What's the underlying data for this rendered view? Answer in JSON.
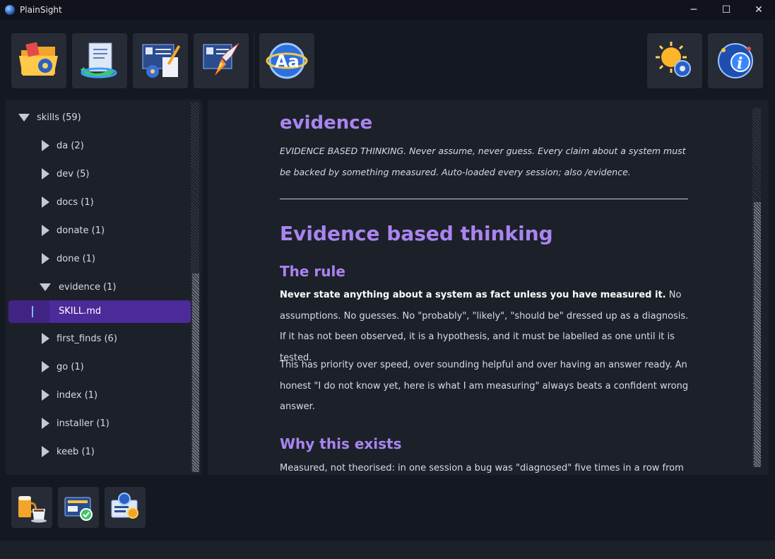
{
  "window": {
    "title": "PlainSight",
    "minimize": "─",
    "maximize": "☐",
    "close": "✕"
  },
  "toolbar": {
    "left_buttons": [
      "open-folder-icon",
      "reload-document-icon",
      "edit-document-icon",
      "publish-document-icon",
      "font-settings-icon"
    ],
    "right_buttons": [
      "theme-settings-icon",
      "about-info-icon"
    ]
  },
  "tree": {
    "root": "skills (59)",
    "items": [
      {
        "label": "da (2)",
        "expanded": false
      },
      {
        "label": "dev (5)",
        "expanded": false
      },
      {
        "label": "docs (1)",
        "expanded": false
      },
      {
        "label": "donate (1)",
        "expanded": false
      },
      {
        "label": "done (1)",
        "expanded": false
      },
      {
        "label": "evidence (1)",
        "expanded": true
      },
      {
        "label": "first_finds (6)",
        "expanded": false
      },
      {
        "label": "go (1)",
        "expanded": false
      },
      {
        "label": "index (1)",
        "expanded": false
      },
      {
        "label": "installer (1)",
        "expanded": false
      },
      {
        "label": "keeb (1)",
        "expanded": false
      }
    ],
    "selected_file": "SKILL.md"
  },
  "content": {
    "skill_name": "evidence",
    "description": "EVIDENCE BASED THINKING. Never assume, never guess. Every claim about a system must be backed by something measured. Auto-loaded every session; also /evidence.",
    "heading": "Evidence based thinking",
    "section1_title": "The rule",
    "section1_bold": "Never state anything about a system as fact unless you have measured it.",
    "section1_rest": " No assumptions. No guesses. No \"probably\", \"likely\", \"should be\" dressed up as a diagnosis. If it has not been observed, it is a hypothesis, and it must be labelled as one until it is tested.",
    "section1_para2": "This has priority over speed, over sounding helpful and over having an answer ready. An honest \"I do not know yet, here is what I am measuring\" always beats a confident wrong answer.",
    "section2_title": "Why this exists",
    "section2_text": "Measured, not theorised: in one session a bug was \"diagnosed\" five times in a row from"
  },
  "bottom_buttons": [
    "donate-coffee-icon",
    "license-ui-icon",
    "license-model-icon"
  ],
  "colors": {
    "accent": "#a985f0",
    "selection": "#4c2a9a",
    "panel": "#1c2029",
    "background": "#141821"
  }
}
